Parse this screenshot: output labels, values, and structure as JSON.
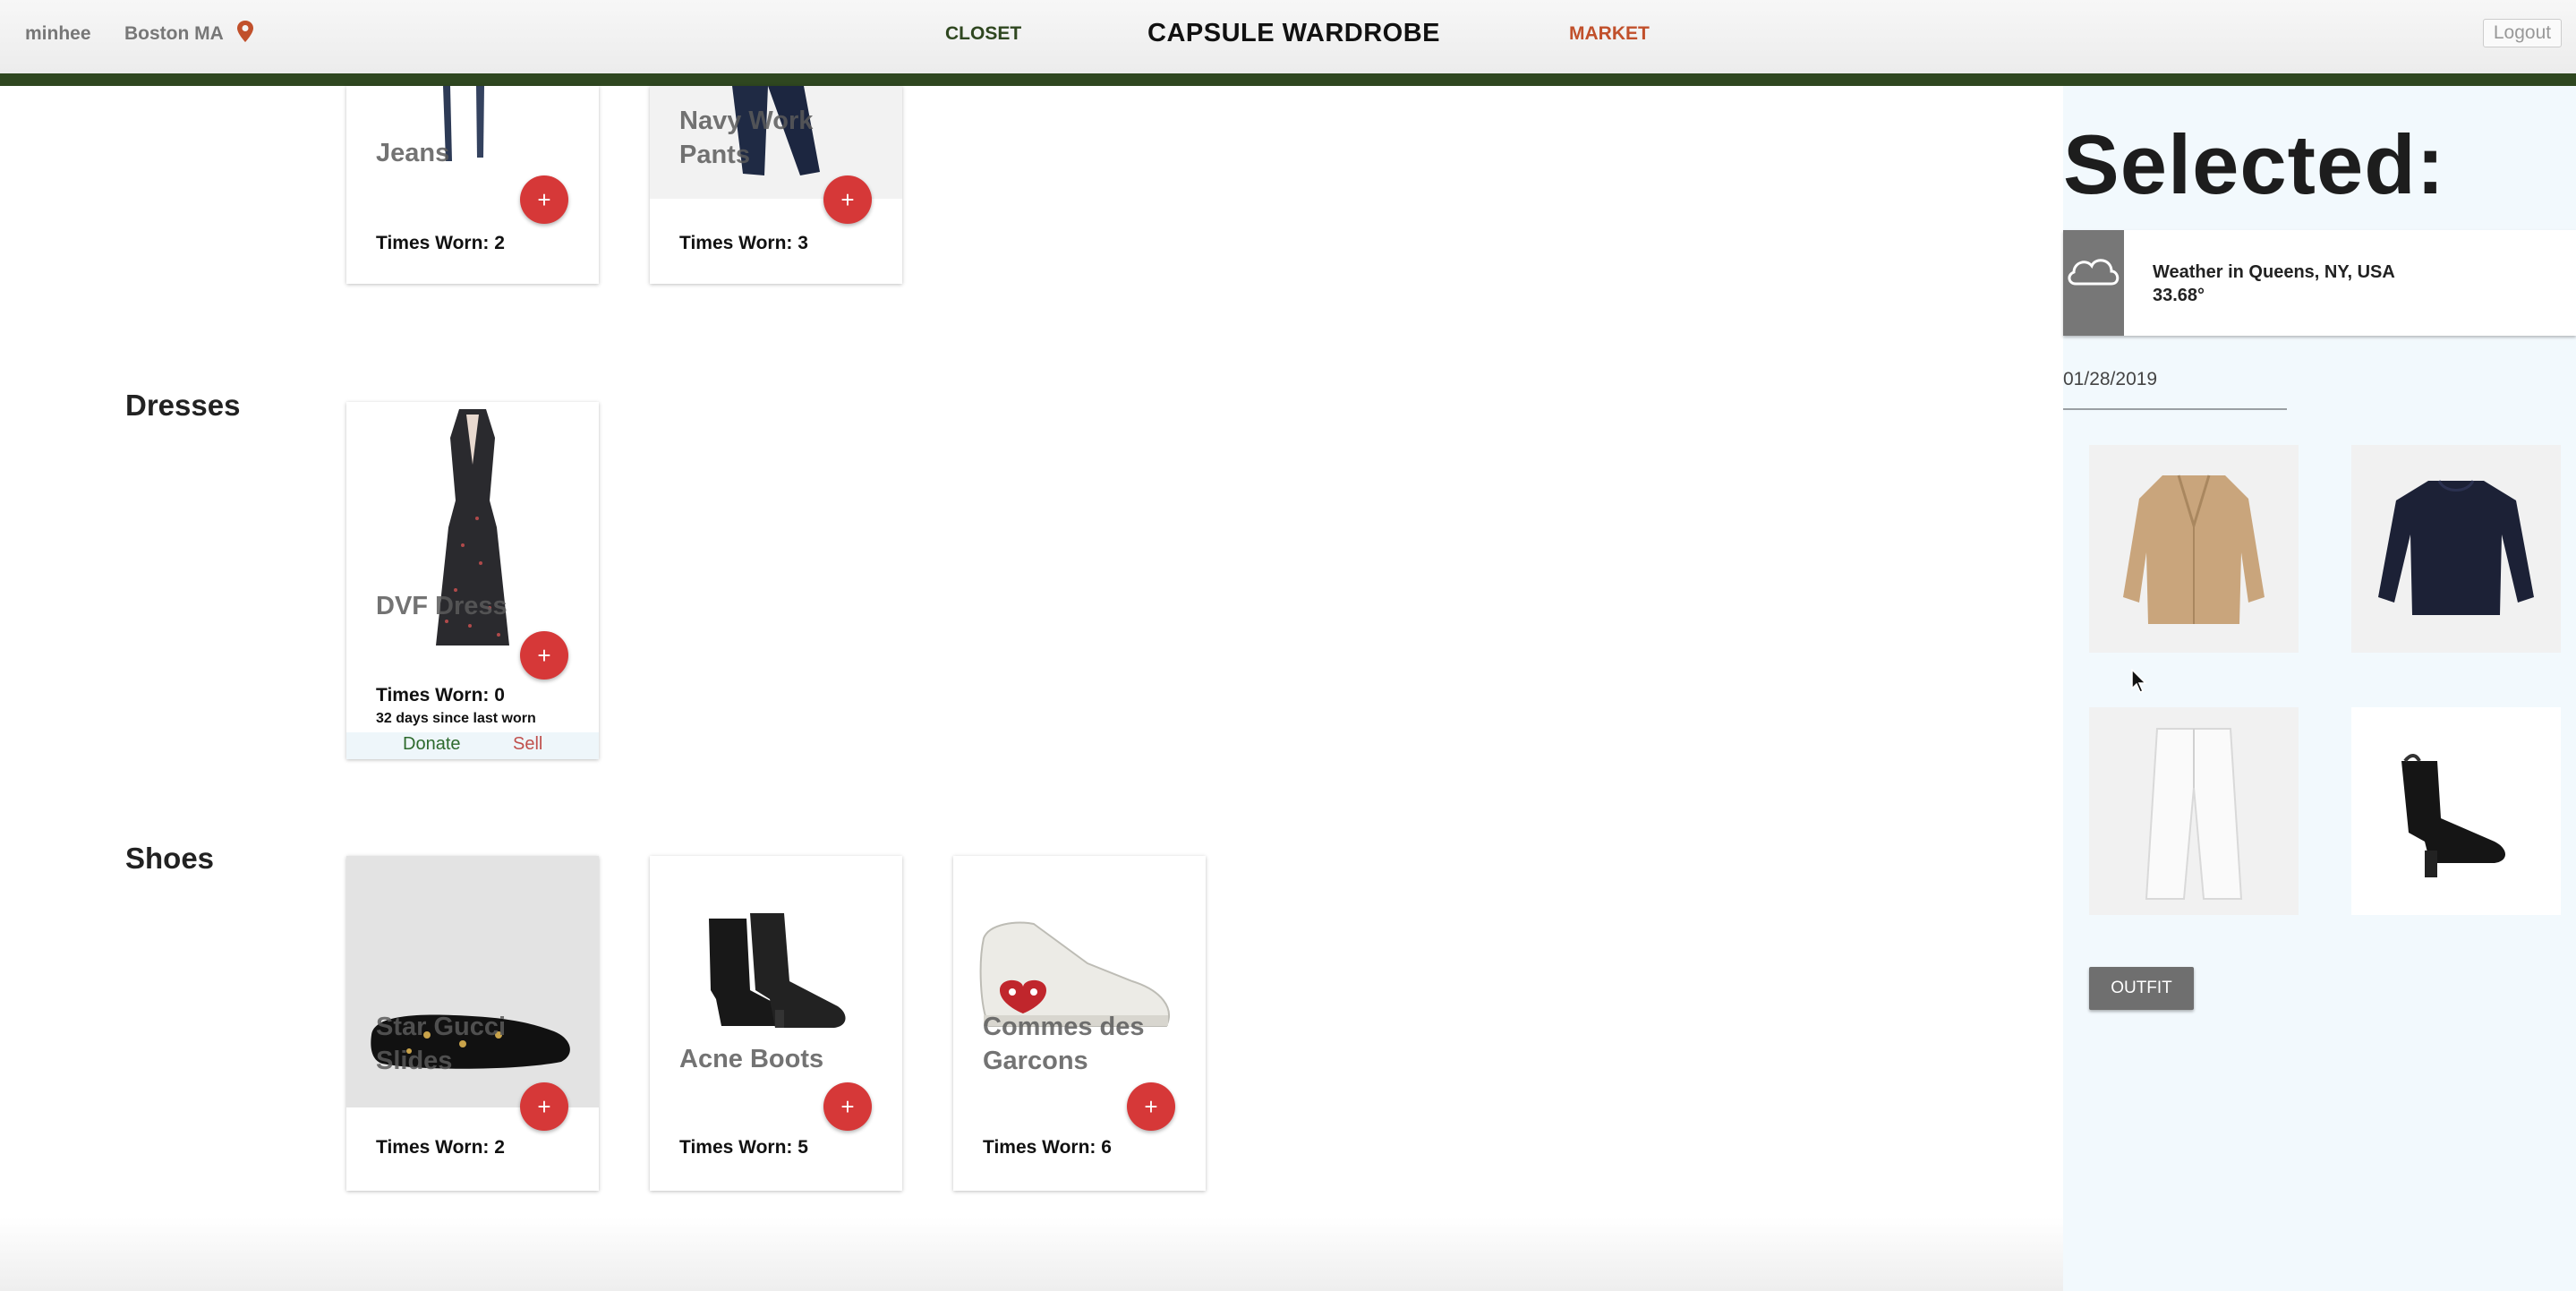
{
  "header": {
    "username": "minhee",
    "location": "Boston MA",
    "nav_closet": "CLOSET",
    "title": "CAPSULE WARDROBE",
    "nav_market": "MARKET",
    "logout": "Logout",
    "colors": {
      "closet": "#2f4720",
      "market": "#c1502b",
      "bar": "#2f4720"
    }
  },
  "sections": {
    "bottoms": {
      "items": [
        {
          "name": "Jeans",
          "worn": "Times Worn: 2",
          "add": "+"
        },
        {
          "name": "Navy Work Pants",
          "worn": "Times Worn: 3",
          "add": "+"
        }
      ]
    },
    "dresses": {
      "title": "Dresses",
      "items": [
        {
          "name": "DVF Dress",
          "worn": "Times Worn: 0",
          "since": "32 days since last worn",
          "donate": "Donate",
          "sell": "Sell",
          "add": "+"
        }
      ]
    },
    "shoes": {
      "title": "Shoes",
      "items": [
        {
          "name": "Star Gucci Slides",
          "worn": "Times Worn: 2",
          "add": "+"
        },
        {
          "name": "Acne Boots",
          "worn": "Times Worn: 5",
          "add": "+"
        },
        {
          "name": "Commes des Garcons",
          "worn": "Times Worn: 6",
          "add": "+"
        }
      ]
    }
  },
  "panel": {
    "title": "Selected:",
    "weather_location": "Weather in Queens, NY, USA",
    "weather_temp": "33.68°",
    "date": "01/28/2019",
    "outfit_button": "OUTFIT"
  },
  "icons": [
    "location-pin-icon",
    "cloud-icon",
    "plus-icon",
    "mouse-cursor-icon"
  ]
}
